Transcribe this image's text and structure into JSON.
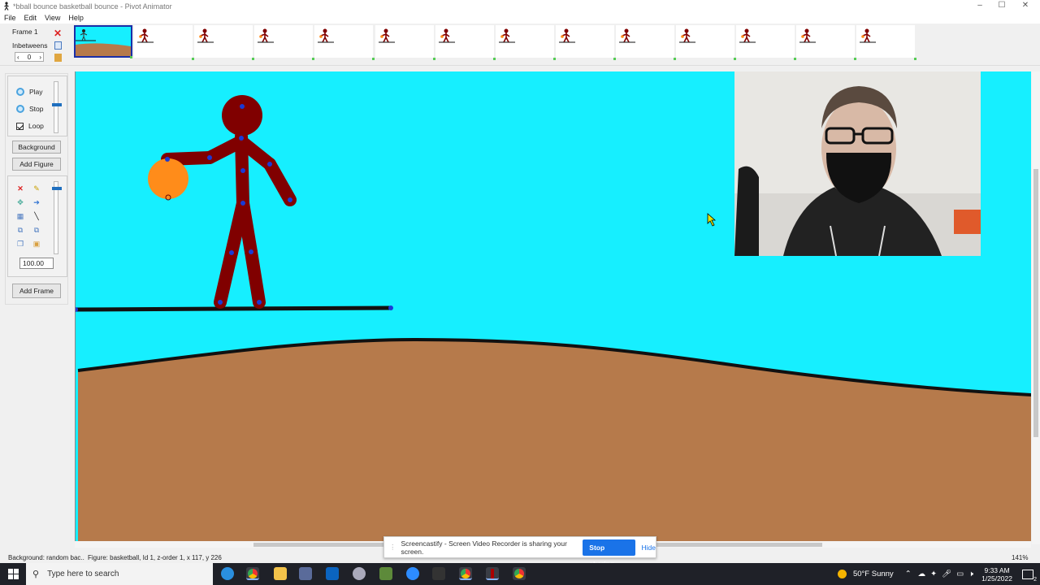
{
  "window": {
    "title": "*bball bounce basketball bounce - Pivot Animator",
    "controls": [
      "–",
      "☐",
      "✕"
    ]
  },
  "menu": [
    "File",
    "Edit",
    "View",
    "Help"
  ],
  "frames": {
    "label": "Frame 1",
    "inbetweens_label": "Inbetweens",
    "inbetweens_value": "0",
    "count": 14,
    "selected": 1
  },
  "controls": {
    "play": "Play",
    "stop": "Stop",
    "loop": "Loop",
    "loop_checked": true
  },
  "buttons": {
    "background": "Background",
    "add_figure": "Add Figure",
    "add_frame": "Add Frame"
  },
  "scale_value": "100.00",
  "status": {
    "background": "Background: random bac..",
    "figure": "Figure: basketball, Id 1,  z-order 1,  x 117, y 226",
    "zoom": "141%"
  },
  "screencastify": {
    "message": "Screencastify - Screen Video Recorder is sharing your screen.",
    "stop": "Stop sharing",
    "hide": "Hide"
  },
  "taskbar": {
    "search_placeholder": "Type here to search",
    "weather": "50°F  Sunny",
    "time": "9:33 AM",
    "date": "1/25/2022",
    "notif_count": "2"
  },
  "colors": {
    "sky": "#16efff",
    "ground": "#b67a4b",
    "figure": "#800000",
    "ball": "#ff8c1a",
    "joint": "#1a3ad6"
  }
}
